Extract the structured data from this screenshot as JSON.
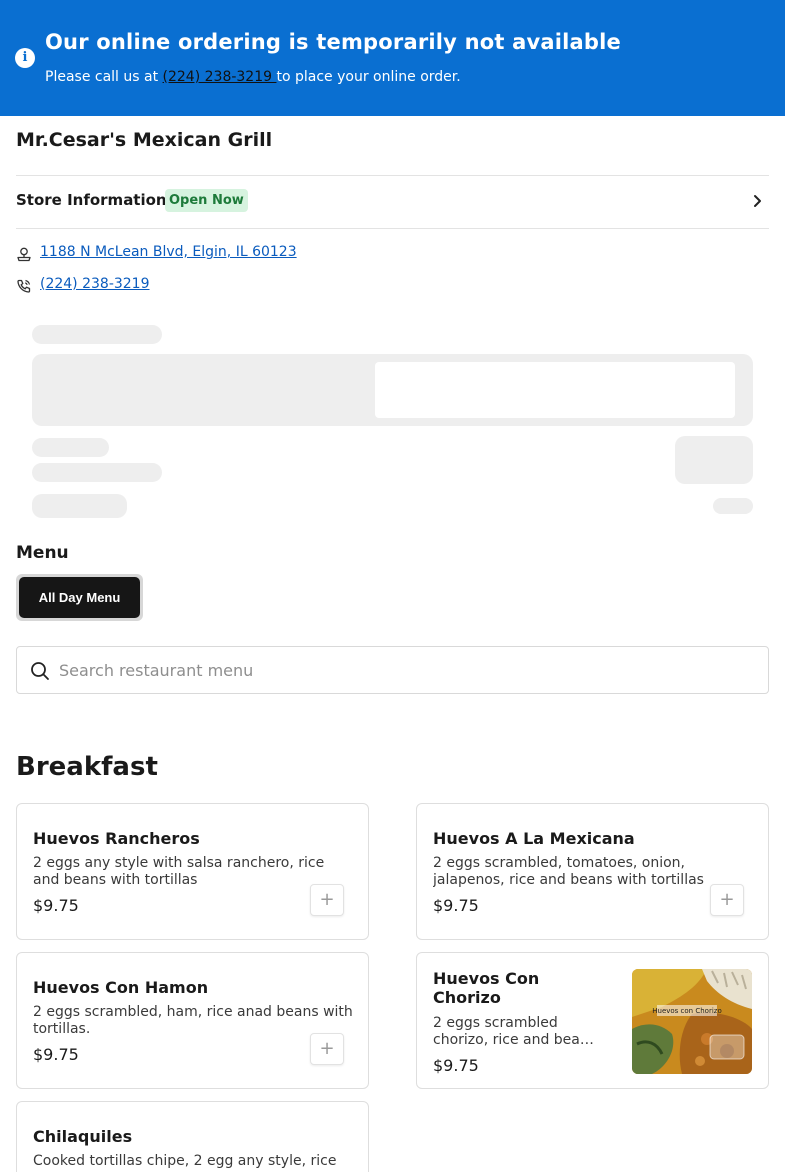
{
  "banner": {
    "icon": "info-icon",
    "title": "Our online ordering is temporarily not available",
    "sub_before": "Please call us at ",
    "phone": "(224) 238-3219 ",
    "sub_after": "to place your online order."
  },
  "store": {
    "name": "Mr.Cesar's Mexican Grill",
    "info_label": "Store Information",
    "status_badge": "Open Now",
    "address": "1188 N McLean Blvd, Elgin, IL 60123",
    "phone": "(224) 238-3219"
  },
  "menu": {
    "heading": "Menu",
    "tab_label": "All Day Menu",
    "search_placeholder": "Search restaurant menu"
  },
  "section": {
    "title": "Breakfast",
    "items": [
      {
        "name": "Huevos Rancheros",
        "description": "2 eggs any style with salsa ranchero, rice and beans with tortillas",
        "price": "$9.75"
      },
      {
        "name": "Huevos A La Mexicana",
        "description": "2 eggs scrambled, tomatoes, onion, jalapenos, rice and beans with tortillas",
        "price": "$9.75"
      },
      {
        "name": "Huevos Con Hamon",
        "description": "2 eggs scrambled, ham, rice anad beans with tortillas.",
        "price": "$9.75"
      },
      {
        "name": "Huevos Con Chorizo",
        "description": "2 eggs scrambled chorizo, rice and bea…",
        "price": "$9.75",
        "image_text": "Huevos con Chorizo"
      },
      {
        "name": "Chilaquiles",
        "description": "Cooked tortillas chipe, 2 egg any style, rice",
        "price": ""
      }
    ]
  },
  "colors": {
    "banner_bg": "#0a6fd1",
    "badge_bg": "#d6f3df",
    "badge_text": "#1d7a3a",
    "link": "#0a5bbd",
    "tab_bg": "#161616"
  }
}
